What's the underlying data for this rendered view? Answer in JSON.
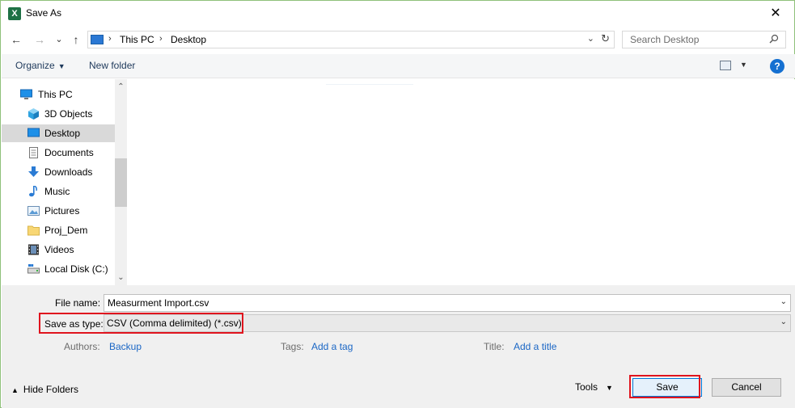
{
  "window": {
    "title": "Save As",
    "app_icon_letter": "X",
    "close_glyph": "✕"
  },
  "nav": {
    "back_glyph": "←",
    "forward_glyph": "→",
    "recent_glyph": "⌄",
    "up_glyph": "↑"
  },
  "address": {
    "sep": "›",
    "crumbs": [
      "This PC",
      "Desktop"
    ],
    "dropdown_glyph": "⌄",
    "refresh_glyph": "↻"
  },
  "search": {
    "placeholder": "Search Desktop"
  },
  "toolbar": {
    "organize_label": "Organize",
    "new_folder_label": "New folder",
    "help_glyph": "?",
    "caret_glyph": "▼"
  },
  "navpane": {
    "items": [
      {
        "label": "This PC",
        "icon": "computer-icon"
      },
      {
        "label": "3D Objects",
        "icon": "cube-icon"
      },
      {
        "label": "Desktop",
        "icon": "desktop-icon",
        "selected": true
      },
      {
        "label": "Documents",
        "icon": "document-icon"
      },
      {
        "label": "Downloads",
        "icon": "download-icon"
      },
      {
        "label": "Music",
        "icon": "music-icon"
      },
      {
        "label": "Pictures",
        "icon": "pictures-icon"
      },
      {
        "label": "Proj_Dem",
        "icon": "folder-icon"
      },
      {
        "label": "Videos",
        "icon": "video-icon"
      },
      {
        "label": "Local Disk (C:)",
        "icon": "disk-icon"
      }
    ],
    "scroll_up_glyph": "⌃",
    "scroll_down_glyph": "⌄"
  },
  "form": {
    "file_name_label": "File name:",
    "file_name_value": "Measurment Import.csv",
    "save_type_label": "Save as type:",
    "save_type_value": "CSV (Comma delimited) (*.csv)",
    "authors_label": "Authors:",
    "authors_value": "Backup",
    "tags_label": "Tags:",
    "tags_value": "Add a tag",
    "title_label": "Title:",
    "title_value": "Add a title",
    "dropdown_glyph": "⌄"
  },
  "footer": {
    "hide_folders_label": "Hide Folders",
    "hide_folders_glyph": "▲",
    "tools_label": "Tools",
    "tools_glyph": "▼",
    "save_label": "Save",
    "cancel_label": "Cancel"
  },
  "colors": {
    "highlight": "#e0141e",
    "link": "#1a66c5",
    "selection": "#d9d9d9",
    "excel_green": "#1e7145"
  }
}
